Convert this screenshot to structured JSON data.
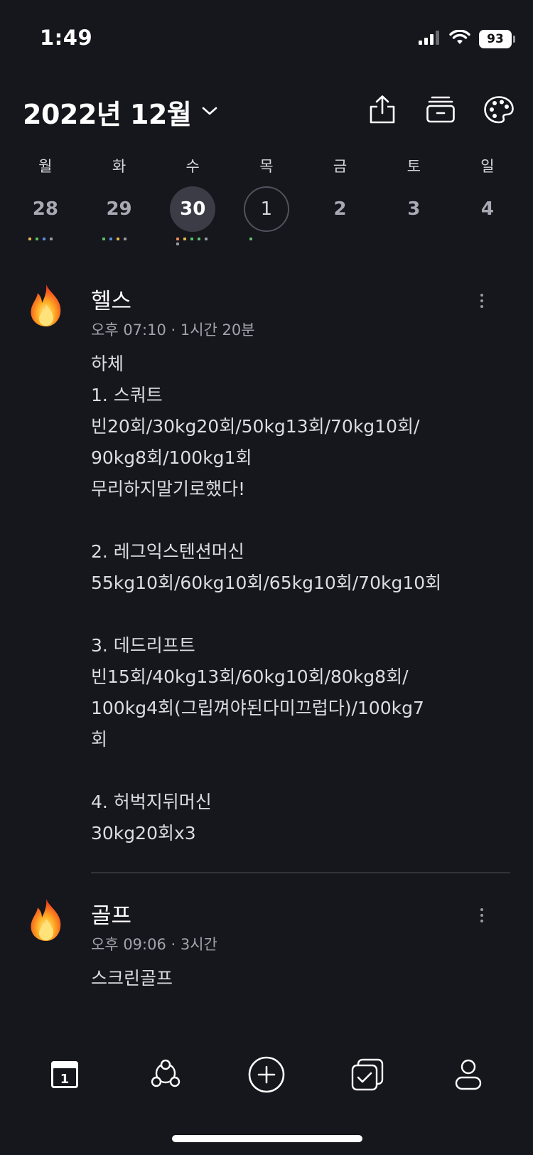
{
  "status": {
    "time": "1:49",
    "battery": "93"
  },
  "header": {
    "month_title": "2022년 12월"
  },
  "week": [
    {
      "name": "월",
      "num": "28",
      "state": "normal",
      "dots": [
        "#e6b84a",
        "#5fbf6a",
        "#5d8fe0",
        "#9a9aa4"
      ]
    },
    {
      "name": "화",
      "num": "29",
      "state": "normal",
      "dots": [
        "#5fbf6a",
        "#5d8fe0",
        "#e6b84a",
        "#9a9aa4"
      ]
    },
    {
      "name": "수",
      "num": "30",
      "state": "selected",
      "dots": [
        "#e88a5a",
        "#e6b84a",
        "#5fbf6a",
        "#5fbf6a",
        "#9a9aa4",
        "#9a9aa4"
      ]
    },
    {
      "name": "목",
      "num": "1",
      "state": "today",
      "dots": [
        "#5fbf6a"
      ]
    },
    {
      "name": "금",
      "num": "2",
      "state": "normal",
      "dots": []
    },
    {
      "name": "토",
      "num": "3",
      "state": "normal",
      "dots": []
    },
    {
      "name": "일",
      "num": "4",
      "state": "normal",
      "dots": []
    }
  ],
  "entries": [
    {
      "title": "헬스",
      "meta": "오후 07:10 · 1시간 20분",
      "body": "하체\n1. 스쿼트\n빈20회/30kg20회/50kg13회/70kg10회/\n90kg8회/100kg1회\n무리하지말기로했다!\n\n2. 레그익스텐션머신\n55kg10회/60kg10회/65kg10회/70kg10회\n\n3. 데드리프트\n빈15회/40kg13회/60kg10회/80kg8회/\n100kg4회(그립껴야된다미끄럽다)/100kg7\n회\n\n4. 허벅지뒤머신\n30kg20회x3"
    },
    {
      "title": "골프",
      "meta": "오후 09:06 · 3시간",
      "body": "스크린골프"
    }
  ],
  "icons": {
    "share": "share-icon",
    "archive": "archive-icon",
    "palette": "palette-icon",
    "entry_icon": "fire-icon"
  },
  "tabs": [
    "calendar-tab",
    "friends-tab",
    "add-tab",
    "todo-tab",
    "profile-tab"
  ],
  "colors": {
    "background": "#16161d",
    "selected_day": "#3c3c47"
  }
}
